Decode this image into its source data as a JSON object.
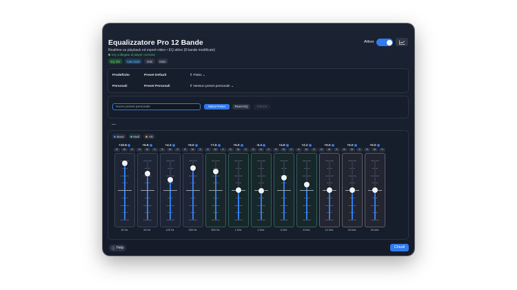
{
  "window": {
    "title": "Equalizzatore Pro 12 Bande",
    "subtitle": "Realtime su playback ed export video • EQ attivo (8 bande modificate)",
    "linked_status": "EQ collegato al player corrente",
    "chips": [
      {
        "label": "EQ ON",
        "style": "green"
      },
      {
        "label": "Auto-Gain",
        "style": "blue"
      },
      {
        "label": "Solo",
        "style": "gray"
      },
      {
        "label": "Mute",
        "style": "gray"
      }
    ],
    "active_label": "Attivo",
    "active_on": true
  },
  "presets": {
    "default_row": {
      "category": "Predefinito",
      "name": "Preset Default",
      "value": "Piatto"
    },
    "personal_row": {
      "category": "Personali",
      "name": "Preset Personali",
      "value": "Nessun preset personale"
    }
  },
  "save": {
    "placeholder": "Nome preset personale",
    "save_label": "Salva Preset",
    "reset_label": "Reset EQ",
    "delete_label": "Elimina"
  },
  "legend": [
    {
      "label": "Bassi",
      "color": "#3d8cf0"
    },
    {
      "label": "Medi",
      "color": "#3fbf8a"
    },
    {
      "label": "Alti",
      "color": "#e0943a"
    }
  ],
  "band_buttons": [
    "B",
    "M",
    "S"
  ],
  "bands": [
    {
      "freq": "32 Hz",
      "value": "+10.8",
      "gain": 10.8,
      "group": "blue"
    },
    {
      "freq": "64 Hz",
      "value": "+6.8",
      "gain": 6.8,
      "group": "blue"
    },
    {
      "freq": "125 Hz",
      "value": "+4.3",
      "gain": 4.3,
      "group": "blue"
    },
    {
      "freq": "250 Hz",
      "value": "+9.0",
      "gain": 9.0,
      "group": "blue"
    },
    {
      "freq": "500 Hz",
      "value": "+7.6",
      "gain": 7.6,
      "group": "teal"
    },
    {
      "freq": "1 kHz",
      "value": "+0.0",
      "gain": 0.0,
      "group": "teal"
    },
    {
      "freq": "2 kHz",
      "value": "-0.4",
      "gain": -0.4,
      "group": "teal"
    },
    {
      "freq": "4 kHz",
      "value": "+4.9",
      "gain": 4.9,
      "group": "teal"
    },
    {
      "freq": "8 kHz",
      "value": "+2.2",
      "gain": 2.2,
      "group": "teal"
    },
    {
      "freq": "12 kHz",
      "value": "+0.0",
      "gain": 0.0,
      "group": "gray"
    },
    {
      "freq": "16 kHz",
      "value": "+0.0",
      "gain": 0.0,
      "group": "gray"
    },
    {
      "freq": "20 kHz",
      "value": "+0.0",
      "gain": 0.0,
      "group": "gray"
    }
  ],
  "footer": {
    "help_label": "Help",
    "close_label": "Chiudi"
  }
}
